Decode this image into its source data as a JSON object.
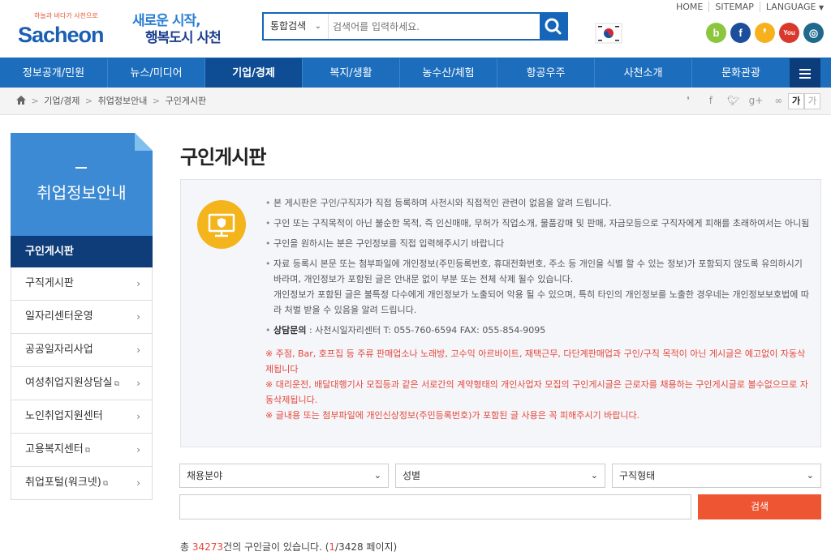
{
  "header": {
    "logo_tagline": "하늘과 바다가 사천으로",
    "logo_text": "Sacheon",
    "slogan_line1": "새로운 시작,",
    "slogan_line2": "행복도시 사천",
    "search": {
      "scope": "통합검색",
      "placeholder": "검색어를 입력하세요."
    },
    "top_links": [
      "HOME",
      "SITEMAP",
      "LANGUAGE"
    ],
    "social": [
      {
        "name": "blog",
        "glyph": "b",
        "color": "#8cc63f"
      },
      {
        "name": "facebook",
        "glyph": "f",
        "color": "#1d4e9c"
      },
      {
        "name": "kakaostory",
        "glyph": "❜",
        "color": "#f6b11c"
      },
      {
        "name": "youtube",
        "glyph": "You",
        "color": "#d9382c"
      },
      {
        "name": "instagram",
        "glyph": "◎",
        "color": "#1f6a8c"
      }
    ]
  },
  "nav": {
    "items": [
      "정보공개/민원",
      "뉴스/미디어",
      "기업/경제",
      "복지/생활",
      "농수산/체험",
      "항공우주",
      "사천소개",
      "문화관광"
    ],
    "active_index": 2
  },
  "breadcrumb": [
    "기업/경제",
    "취업정보안내",
    "구인게시판"
  ],
  "font_buttons": [
    "가",
    "가"
  ],
  "sidebar": {
    "title": "취업정보안내",
    "items": [
      {
        "label": "구인게시판",
        "active": true,
        "external": false
      },
      {
        "label": "구직게시판",
        "active": false,
        "external": false
      },
      {
        "label": "일자리센터운영",
        "active": false,
        "external": false
      },
      {
        "label": "공공일자리사업",
        "active": false,
        "external": false
      },
      {
        "label": "여성취업지원상담실",
        "active": false,
        "external": true
      },
      {
        "label": "노인취업지원센터",
        "active": false,
        "external": false
      },
      {
        "label": "고용복지센터",
        "active": false,
        "external": true
      },
      {
        "label": "취업포털(워크넷)",
        "active": false,
        "external": true
      }
    ]
  },
  "main": {
    "title": "구인게시판",
    "notice": {
      "items": [
        "본 게시판은 구인/구직자가 직접 등록하며 사천시와 직접적인 관련이 없음을 알려 드립니다.",
        "구인 또는 구직목적이 아닌 불순한 목적, 즉 인신매매, 무허가 직업소개, 물품강매 및 판매, 자금모등으로 구직자에게 피해를 초래하여서는 아니됨",
        "구인을 원하시는 분은 구인정보를 직접 입력해주시기 바랍니다",
        "자료 등록시 본문 또는 첨부파일에 개인정보(주민등록번호, 휴대전화번호, 주소 등 개인을 식별 할 수 있는 정보)가 포함되지 않도록 유의하시기 바라며, 개인정보가 포함된 글은 안내문 없이 부분 또는 전체 삭제 될수 있습니다."
      ],
      "extra": "개인정보가 포함된 글은 불특정 다수에게 개인정보가 노출되어 악용 될 수 있으며, 특히 타인의 개인정보를 노출한 경우네는 개인정보보호법에 따라 처벌 받을 수 있음을 알려 드립니다.",
      "contact_label": "상담문의",
      "contact_text": " : 사천시일자리센터 T: 055-760-6594 FAX: 055-854-9095",
      "warnings": [
        "※ 주점, Bar, 호프집 등 주류 판매업소나 노래방, 고수익 아르바이트, 재택근무, 다단계판매업과 구인/구직 목적이 아닌 게시글은 예고없이 자동삭제됩니다",
        "※ 대리운전, 배달대행기사 모집등과 같은 서로간의 계약형태의 개인사업자 모집의 구인게시글은 근로자를 채용하는 구인게시글로 볼수없으므로 자동삭제됩니다.",
        "※ 글내용 또는 첨부파일에 개인신상정보(주민등록번호)가 포함된 글 사용은 꼭 피해주시기 바랍니다."
      ]
    },
    "filters": {
      "field": "채용분야",
      "gender": "성별",
      "type": "구직형태"
    },
    "search_button": "검색",
    "total": {
      "prefix": "총 ",
      "count": "34273",
      "mid": "건의 구인글이 있습니다. (",
      "page": "1",
      "suffix": "/3428 페이지)"
    }
  }
}
